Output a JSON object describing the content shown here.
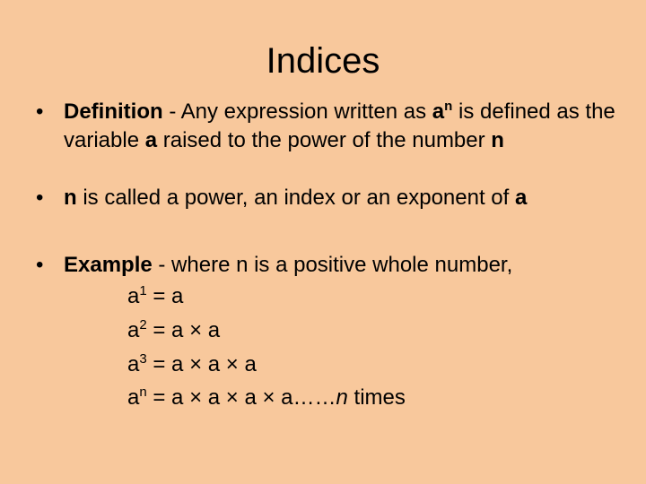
{
  "title": "Indices",
  "bullets": {
    "definition": {
      "label": "Definition",
      "sep": " - Any expression written as ",
      "base": "a",
      "exp": "n",
      "text2": " is defined as the variable ",
      "var": "a",
      "text3": " raised to the power of the number ",
      "num": "n"
    },
    "power": {
      "n": "n",
      "text": " is called a power, an index or an exponent of ",
      "a": "a"
    },
    "example": {
      "label": "Example",
      "text": " - where n is a positive whole number,"
    }
  },
  "equations": [
    {
      "base": "a",
      "exp": "1",
      "rhs": " = a"
    },
    {
      "base": "a",
      "exp": "2",
      "rhs": " = a × a"
    },
    {
      "base": "a",
      "exp": "3",
      "rhs": " = a × a × a"
    },
    {
      "base": "a",
      "exp": "n",
      "rhs": " = a × a × a × a……",
      "italic": "n",
      "tail": " times"
    }
  ],
  "bullet_glyph": "•"
}
